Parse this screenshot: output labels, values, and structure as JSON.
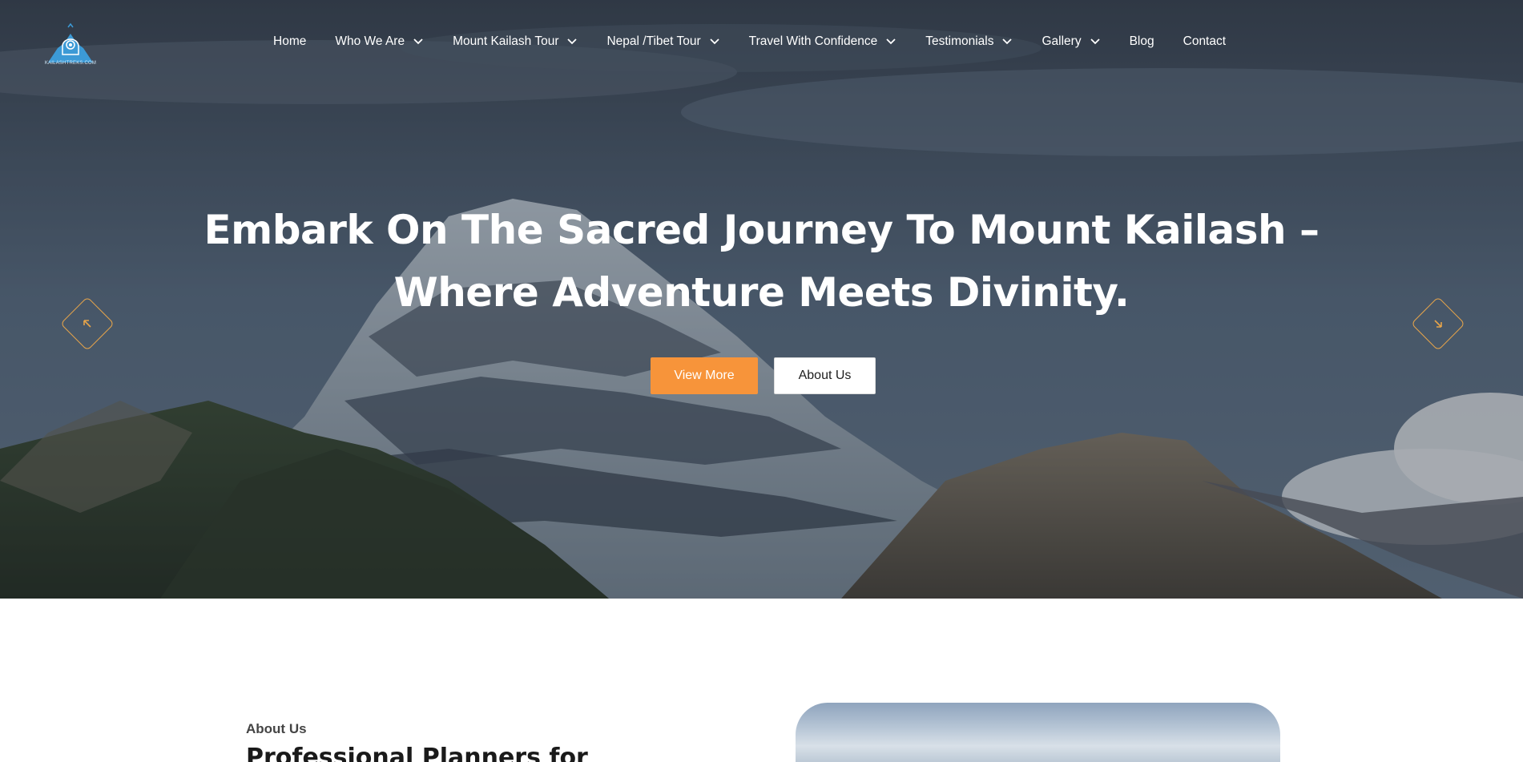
{
  "brand": {
    "logo_text": "KAILASHTREKS.COM",
    "accent": "#f7943a",
    "logo_color": "#3c9ad6"
  },
  "nav": {
    "items": [
      {
        "label": "Home",
        "has_dropdown": false
      },
      {
        "label": "Who We Are",
        "has_dropdown": true
      },
      {
        "label": "Mount Kailash Tour",
        "has_dropdown": true
      },
      {
        "label": "Nepal /Tibet Tour",
        "has_dropdown": true
      },
      {
        "label": "Travel With Confidence",
        "has_dropdown": true
      },
      {
        "label": "Testimonials",
        "has_dropdown": true
      },
      {
        "label": "Gallery",
        "has_dropdown": true
      },
      {
        "label": "Blog",
        "has_dropdown": false
      },
      {
        "label": "Contact",
        "has_dropdown": false
      }
    ]
  },
  "hero": {
    "title_line1": "Embark On The Sacred Journey To Mount Kailash –",
    "title_line2": "Where Adventure Meets Divinity.",
    "primary_button": "View More",
    "secondary_button": "About Us",
    "prev_icon": "arrow-up-left-icon",
    "next_icon": "arrow-down-right-icon"
  },
  "about": {
    "label": "About Us",
    "heading": "Professional Planners for"
  }
}
